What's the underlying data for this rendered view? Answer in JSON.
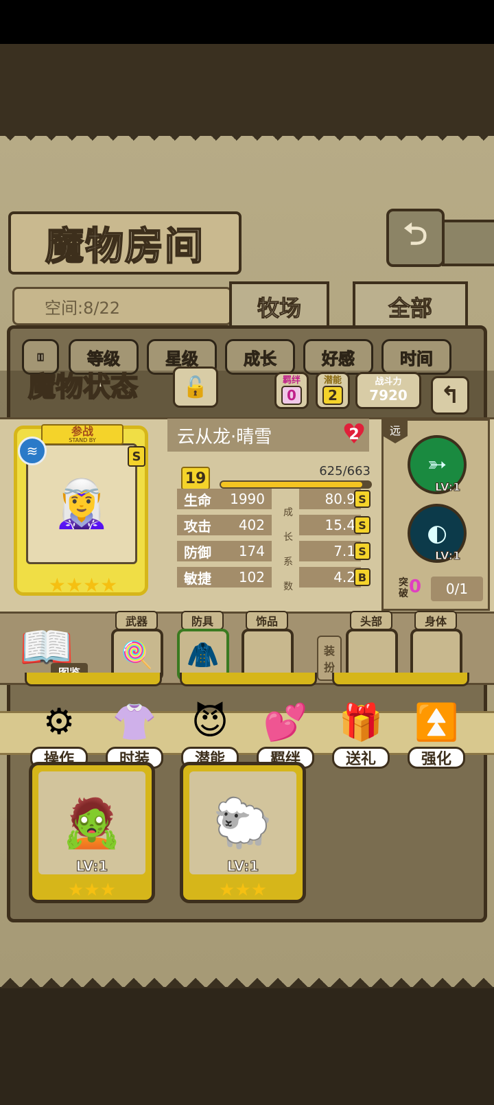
{
  "window": {
    "title": "魔物房间"
  },
  "header": {
    "space_label": "空间:8/22",
    "back_icon": "return-arrow-icon"
  },
  "tabs": [
    {
      "label": "牧场",
      "active": true
    },
    {
      "label": "全部",
      "active": false
    }
  ],
  "sort_buttons": [
    "等级",
    "星级",
    "成长",
    "好感",
    "时间"
  ],
  "status": {
    "title": "魔物状态",
    "bond_label": "羁绊",
    "bond_value": "0",
    "potential_label": "潜能",
    "potential_value": "2",
    "power_label": "战斗力",
    "power_value": "7920",
    "name": "云从龙·晴雪",
    "heart_value": "2",
    "standby": "参战",
    "standby_en": "STAND BY",
    "rank": "S",
    "level": "19",
    "exp_text": "625/663",
    "exp_fraction": 0.943,
    "stars": "★★★★",
    "stats": [
      {
        "label": "生命",
        "value": "1990",
        "growth": "80.9",
        "grade": "S"
      },
      {
        "label": "攻击",
        "value": "402",
        "growth": "15.4",
        "grade": "S"
      },
      {
        "label": "防御",
        "value": "174",
        "growth": "7.1",
        "grade": "S"
      },
      {
        "label": "敏捷",
        "value": "102",
        "growth": "4.2",
        "grade": "B"
      }
    ],
    "growth_vertical": [
      "成",
      "长",
      "系",
      "数"
    ],
    "range": "远",
    "skills": [
      {
        "level": "LV:1"
      },
      {
        "level": "LV:1"
      }
    ],
    "breakthrough_label": [
      "突",
      "破"
    ],
    "breakthrough_value": "0",
    "breakthrough_count": "0/1"
  },
  "equipment": {
    "book_label": "图鉴",
    "slots": [
      {
        "label": "武器",
        "icon": "lollipop-icon",
        "glyph": "🍭"
      },
      {
        "label": "防具",
        "icon": "armor-icon",
        "glyph": "🧥"
      },
      {
        "label": "饰品",
        "icon": "",
        "glyph": ""
      },
      {
        "label": "头部",
        "icon": "",
        "glyph": ""
      },
      {
        "label": "身体",
        "icon": "",
        "glyph": ""
      }
    ],
    "dress_label": [
      "装",
      "扮"
    ]
  },
  "actions": [
    {
      "label": "操作",
      "icon": "gear-icon",
      "glyph": "⚙"
    },
    {
      "label": "时装",
      "icon": "outfit-icon",
      "glyph": "👚"
    },
    {
      "label": "潜能",
      "icon": "demon-icon",
      "glyph": "😈"
    },
    {
      "label": "羁绊",
      "icon": "hearts-icon",
      "glyph": "💕"
    },
    {
      "label": "送礼",
      "icon": "gift-icon",
      "glyph": "🎁"
    },
    {
      "label": "强化",
      "icon": "upgrade-arrows-icon",
      "glyph": "⏫"
    }
  ],
  "monsters": [
    {
      "level": "LV:1",
      "stars": "★★★"
    },
    {
      "level": "LV:1",
      "stars": "★★★"
    }
  ]
}
